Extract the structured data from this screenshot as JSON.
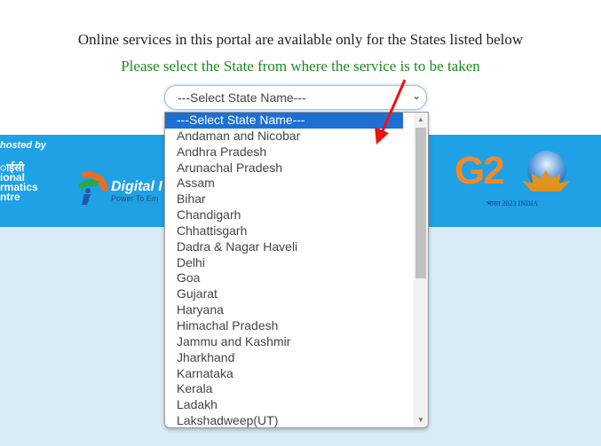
{
  "header": {
    "notice": "Online services in this portal are available only for the States listed below",
    "instruction": "Please select the State from where the service is to be taken"
  },
  "state_select": {
    "value": "---Select State Name---",
    "options": [
      "---Select State Name---",
      "Andaman and Nicobar",
      "Andhra Pradesh",
      "Arunachal Pradesh",
      "Assam",
      "Bihar",
      "Chandigarh",
      "Chhattisgarh",
      "Dadra & Nagar Haveli",
      "Delhi",
      "Goa",
      "Gujarat",
      "Haryana",
      "Himachal Pradesh",
      "Jammu and Kashmir",
      "Jharkhand",
      "Karnataka",
      "Kerala",
      "Ladakh",
      "Lakshadweep(UT)"
    ]
  },
  "banner": {
    "hosted_by": "hosted by",
    "nic_hindi": "ाईसी",
    "nic_lines": [
      "ional",
      "rmatics",
      "ntre"
    ],
    "digital_india": "Digital I",
    "digital_india_sub": "Power To Em",
    "g20": "G2",
    "g20_sub": "भारत 2023 INDIA"
  },
  "colors": {
    "band": "#1fa1e6",
    "selected": "#1e6fd4",
    "instruction": "#1e8a1e",
    "annotation_arrow": "#ee1111"
  }
}
